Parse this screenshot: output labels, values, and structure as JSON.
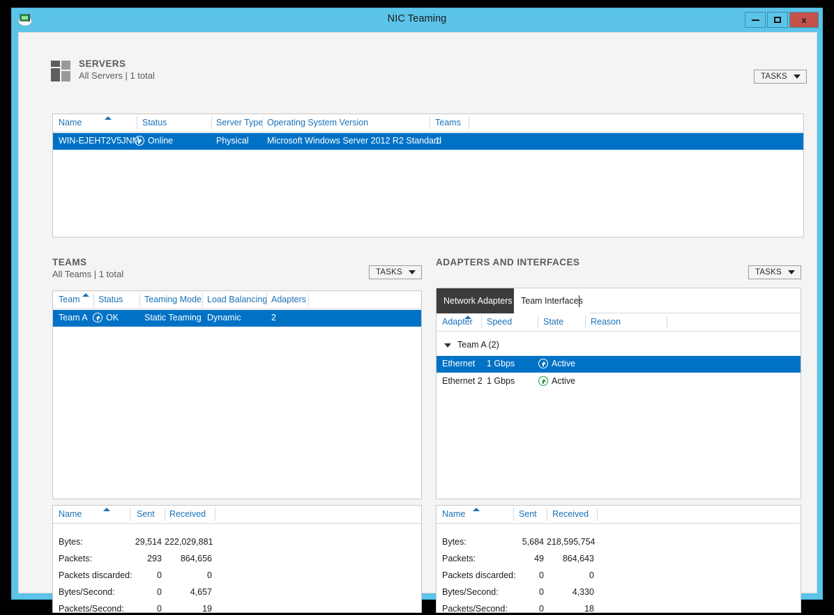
{
  "window": {
    "title": "NIC Teaming",
    "app_icon": "network-adapter-icon",
    "minimize_label": "Minimize",
    "maximize_label": "Maximize",
    "close_label": "x"
  },
  "colors": {
    "frame": "#5BC4E8",
    "close": "#C5534C",
    "selection": "#0072C6",
    "header_text": "#1A72B8",
    "active_tab": "#3C3C3C",
    "status_green": "#1E9E3E"
  },
  "servers": {
    "title": "SERVERS",
    "subtitle": "All Servers | 1 total",
    "tasks_label": "TASKS",
    "columns": [
      "Name",
      "Status",
      "Server Type",
      "Operating System Version",
      "Teams"
    ],
    "sort_column": "Name",
    "rows": [
      {
        "name": "WIN-EJEHT2V5JNM",
        "status": "Online",
        "status_icon": "up-arrow-icon",
        "server_type": "Physical",
        "os_version": "Microsoft Windows Server 2012 R2 Standard",
        "teams": "1",
        "selected": true
      }
    ]
  },
  "teams": {
    "title": "TEAMS",
    "subtitle": "All Teams | 1 total",
    "tasks_label": "TASKS",
    "columns": [
      "Team",
      "Status",
      "Teaming Mode",
      "Load Balancing",
      "Adapters"
    ],
    "sort_column": "Team",
    "rows": [
      {
        "team": "Team A",
        "status": "OK",
        "status_icon": "up-arrow-icon",
        "teaming_mode": "Static Teaming",
        "load_balancing": "Dynamic",
        "adapters": "2",
        "selected": true
      }
    ],
    "stats": {
      "columns": [
        "Name",
        "Sent",
        "Received"
      ],
      "sort_column": "Name",
      "rows": [
        {
          "name": "Bytes:",
          "sent": "29,514",
          "received": "222,029,881"
        },
        {
          "name": "Packets:",
          "sent": "293",
          "received": "864,656"
        },
        {
          "name": "Packets discarded:",
          "sent": "0",
          "received": "0"
        },
        {
          "name": "Bytes/Second:",
          "sent": "0",
          "received": "4,657"
        },
        {
          "name": "Packets/Second:",
          "sent": "0",
          "received": "19"
        }
      ]
    }
  },
  "adapters": {
    "title": "ADAPTERS AND INTERFACES",
    "tasks_label": "TASKS",
    "tabs": [
      {
        "label": "Network Adapters",
        "active": true
      },
      {
        "label": "Team Interfaces",
        "active": false
      }
    ],
    "columns": [
      "Adapter",
      "Speed",
      "State",
      "Reason"
    ],
    "sort_column": "Adapter",
    "group": {
      "label": "Team A (2)",
      "expanded": true,
      "expander_icon": "triangle-down-icon"
    },
    "rows": [
      {
        "adapter": "Ethernet",
        "speed": "1 Gbps",
        "state": "Active",
        "state_icon": "up-arrow-icon",
        "reason": "",
        "selected": true
      },
      {
        "adapter": "Ethernet 2",
        "speed": "1 Gbps",
        "state": "Active",
        "state_icon": "up-arrow-icon",
        "reason": "",
        "selected": false
      }
    ],
    "stats": {
      "columns": [
        "Name",
        "Sent",
        "Received"
      ],
      "sort_column": "Name",
      "rows": [
        {
          "name": "Bytes:",
          "sent": "5,684",
          "received": "218,595,754"
        },
        {
          "name": "Packets:",
          "sent": "49",
          "received": "864,643"
        },
        {
          "name": "Packets discarded:",
          "sent": "0",
          "received": "0"
        },
        {
          "name": "Bytes/Second:",
          "sent": "0",
          "received": "4,330"
        },
        {
          "name": "Packets/Second:",
          "sent": "0",
          "received": "18"
        }
      ]
    }
  }
}
